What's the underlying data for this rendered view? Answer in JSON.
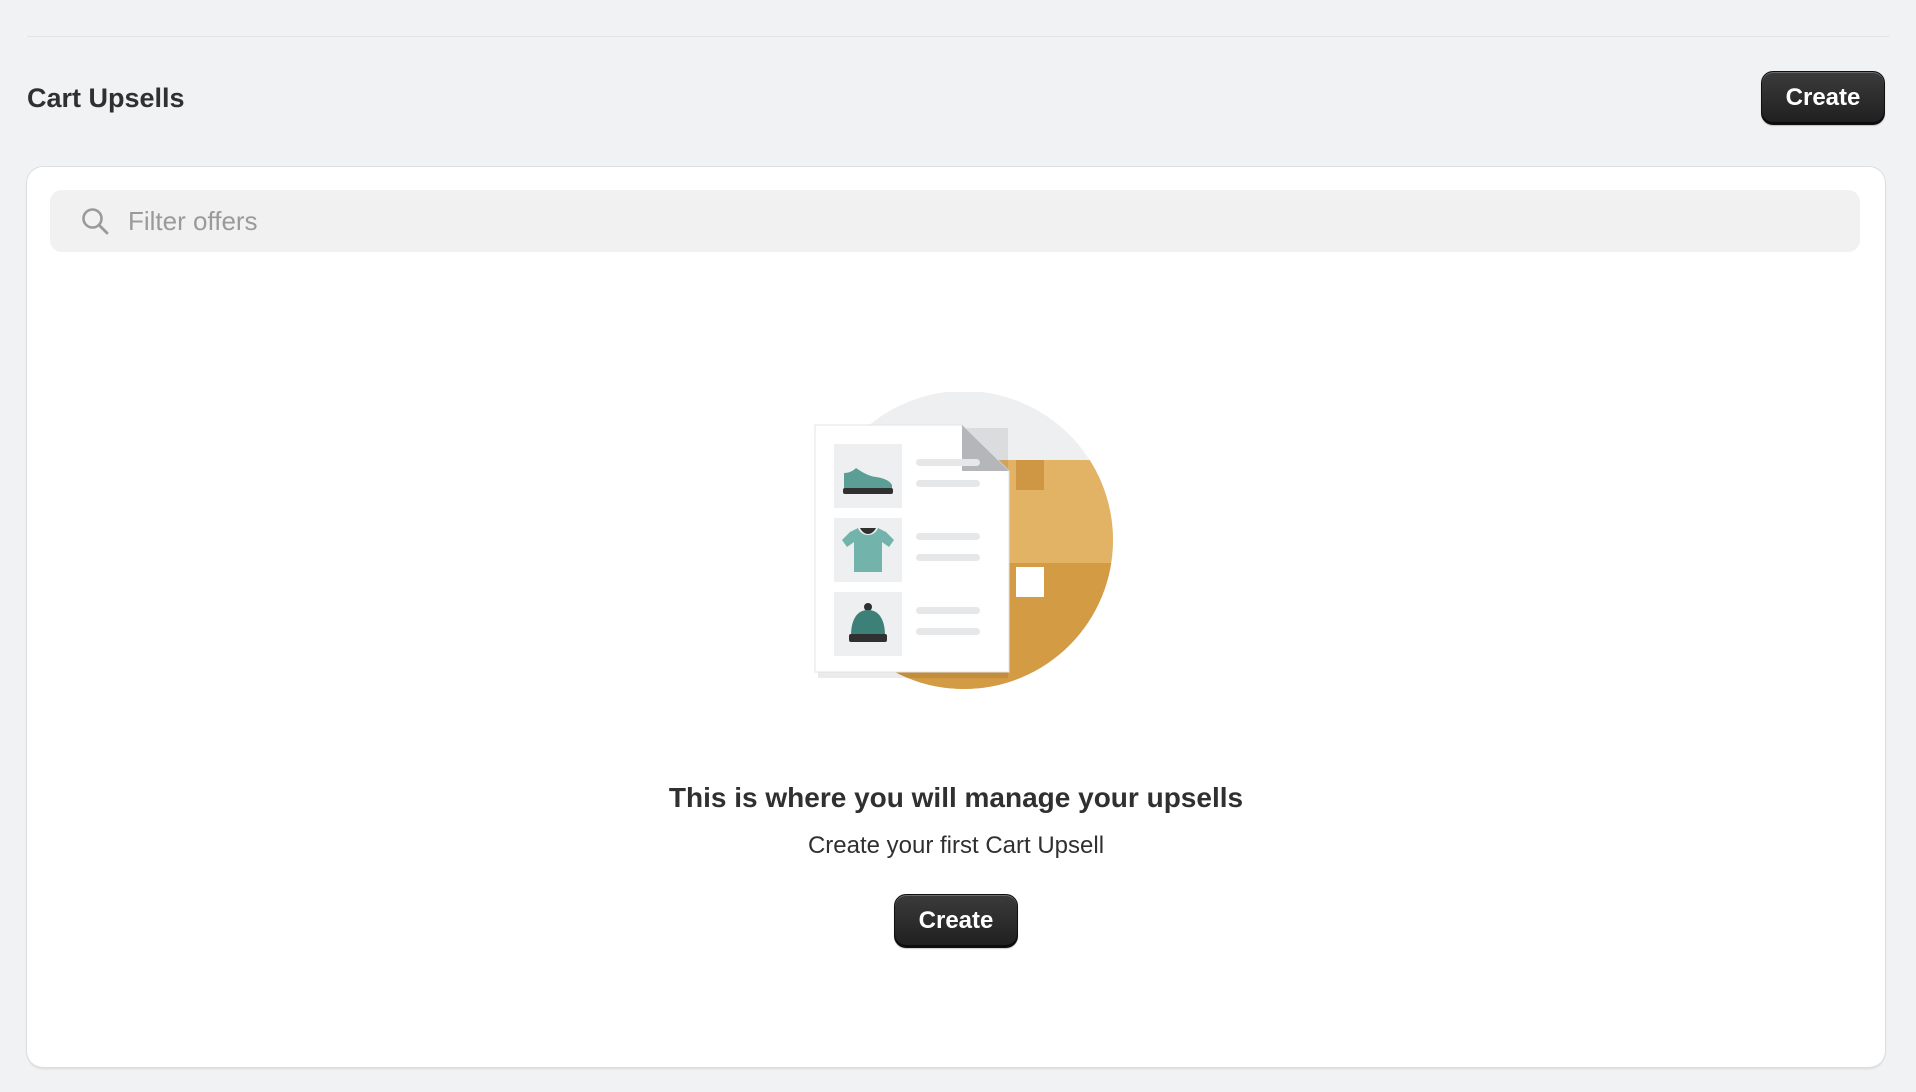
{
  "page": {
    "title": "Cart Upsells",
    "create_label": "Create"
  },
  "search": {
    "placeholder": "Filter offers",
    "value": ""
  },
  "empty_state": {
    "heading": "This is where you will manage your upsells",
    "subtext": "Create your first Cart Upsell",
    "create_label": "Create"
  },
  "colors": {
    "background": "#f1f2f4",
    "card": "#ffffff",
    "button": "#303030",
    "box_orange": "#d89a45",
    "product_teal": "#6bb0a8"
  }
}
